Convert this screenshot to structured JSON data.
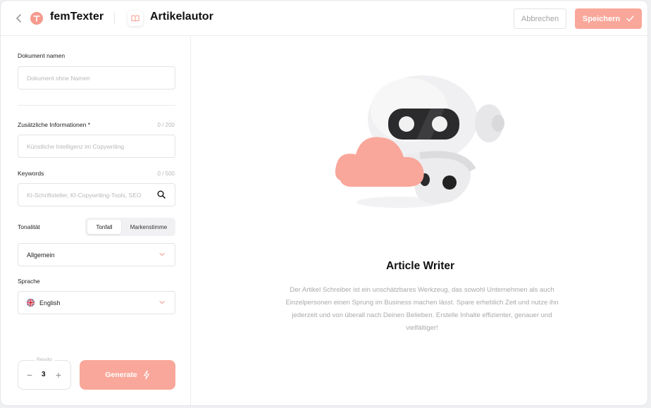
{
  "header": {
    "app_name": "femTexter",
    "tool_title": "Artikelautor",
    "cancel_label": "Abbrechen",
    "save_label": "Speichern"
  },
  "form": {
    "doc_name_label": "Dokument namen",
    "doc_name_placeholder": "Dokument ohne Namen",
    "info_label": "Zusätzliche Informationen *",
    "info_count": "0 / 200",
    "info_placeholder": "Künstliche Intelligenz im Copywriting",
    "keywords_label": "Keywords",
    "keywords_count": "0 / 500",
    "keywords_placeholder": "KI-Schriftsteller, KI-Copywriting-Tools, SEO",
    "tone_label": "Tonalität",
    "tone_options": [
      "Tonfall",
      "Markenstimme"
    ],
    "tone_selected": "Allgemein",
    "language_label": "Sprache",
    "language_selected": "English",
    "results_label": "Results",
    "results_value": "3",
    "generate_label": "Generate"
  },
  "main": {
    "title": "Article Writer",
    "description": "Der Artikel Schreiber ist ein unschätzbares Werkzeug, das sowohl Unternehmen als auch Einzelpersonen einen Sprung im Business machen lässt. Spare erheblich Zeit und nutze ihn jederzeit und von überall nach Deinen Belieben. Erstelle Inhalte effizienter, genauer und vielfältiger!"
  },
  "colors": {
    "accent": "#f9a79a",
    "brand": "#f59b8e"
  },
  "icons": {
    "back": "chevron-left-icon",
    "logo": "femtexter-logo-icon",
    "tool": "book-icon",
    "save": "check-icon",
    "search": "search-icon",
    "dropdown": "chevron-down-icon",
    "flag": "uk-flag-icon",
    "generate": "lightning-icon"
  }
}
